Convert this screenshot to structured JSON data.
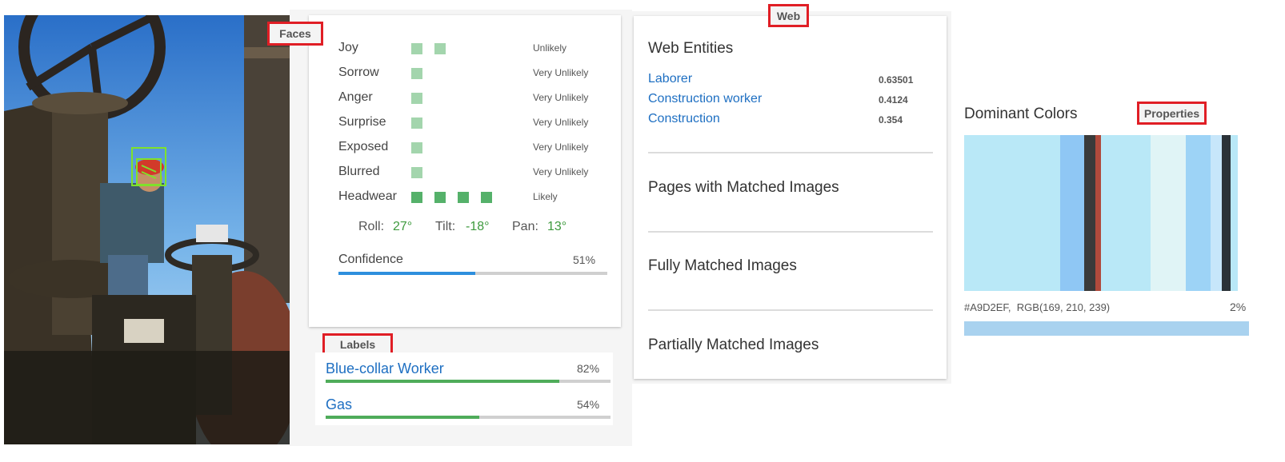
{
  "photo": {
    "face_box_color": "#7fe22b"
  },
  "tags": {
    "faces": "Faces",
    "labels": "Labels",
    "web": "Web",
    "properties": "Properties"
  },
  "faces": {
    "rows": [
      {
        "label": "Joy",
        "likelihood": "Unlikely",
        "level": 2
      },
      {
        "label": "Sorrow",
        "likelihood": "Very Unlikely",
        "level": 1
      },
      {
        "label": "Anger",
        "likelihood": "Very Unlikely",
        "level": 1
      },
      {
        "label": "Surprise",
        "likelihood": "Very Unlikely",
        "level": 1
      },
      {
        "label": "Exposed",
        "likelihood": "Very Unlikely",
        "level": 1
      },
      {
        "label": "Blurred",
        "likelihood": "Very Unlikely",
        "level": 1
      },
      {
        "label": "Headwear",
        "likelihood": "Likely",
        "level": 4
      }
    ],
    "angles": {
      "roll_label": "Roll:",
      "roll": "27°",
      "tilt_label": "Tilt:",
      "tilt": "-18°",
      "pan_label": "Pan:",
      "pan": "13°"
    },
    "confidence_label": "Confidence",
    "confidence_text": "51%",
    "confidence": 0.51
  },
  "labels": [
    {
      "name": "Blue-collar Worker",
      "pct_text": "82%",
      "score": 0.82
    },
    {
      "name": "Gas",
      "pct_text": "54%",
      "score": 0.54
    }
  ],
  "web": {
    "title": "Web Entities",
    "entities": [
      {
        "name": "Laborer",
        "score": "0.63501"
      },
      {
        "name": "Construction worker",
        "score": "0.4124"
      },
      {
        "name": "Construction",
        "score": "0.354"
      }
    ],
    "sections": [
      "Pages with Matched Images",
      "Fully Matched Images",
      "Partially Matched Images"
    ]
  },
  "properties": {
    "title": "Dominant Colors",
    "swatches": [
      {
        "color": "#b9e8f7",
        "weight": 0.35
      },
      {
        "color": "#8fc7f4",
        "weight": 0.09
      },
      {
        "color": "#3a3a3a",
        "weight": 0.04
      },
      {
        "color": "#b04a3c",
        "weight": 0.02
      },
      {
        "color": "#b9e8f7",
        "weight": 0.18
      },
      {
        "color": "#e0f4f6",
        "weight": 0.13
      },
      {
        "color": "#9dd3f6",
        "weight": 0.09
      },
      {
        "color": "#c7e6fa",
        "weight": 0.04
      },
      {
        "color": "#2b3238",
        "weight": 0.035
      },
      {
        "color": "#b9e8f7",
        "weight": 0.025
      }
    ],
    "hex": "#A9D2EF,",
    "rgb": "RGB(169, 210, 239)",
    "percent_text": "2%",
    "bar_color": "#a9d2ef"
  }
}
